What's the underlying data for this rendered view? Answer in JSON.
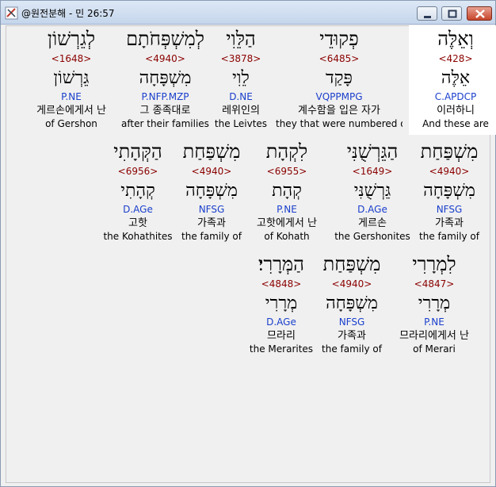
{
  "window": {
    "title": "@원전분해 - 민 26:57"
  },
  "words": [
    {
      "hebrew": "וְאֵלֶּה",
      "number": "<428>",
      "lemma": "אֵלֶּה",
      "morph": "C.APDCP",
      "korean": "이러하니",
      "english": "And these are",
      "highlighted": true
    },
    {
      "hebrew": "פְקוּדֵי",
      "number": "<6485>",
      "lemma": "פָּקַד",
      "morph": "VQPPMPG",
      "korean": "계수함을 입은 자가",
      "english": "they that were numbered of"
    },
    {
      "hebrew": "הַלֵּוִי",
      "number": "<3878>",
      "lemma": "לֵוִי",
      "morph": "D.NE",
      "korean": "레위인의",
      "english": "the Leivtes"
    },
    {
      "hebrew": "לְמִשְׁפְּחֹתָם",
      "number": "<4940>",
      "lemma": "מִשְׁפָּחָה",
      "morph": "P.NFP.MZP",
      "korean": "그 종족대로",
      "english": "after their families"
    },
    {
      "hebrew": "לְגֵרְשׁוֹן",
      "number": "<1648>",
      "lemma": "גֵּרְשׁוֹן",
      "morph": "P.NE",
      "korean": "게르손에게서 난",
      "english": "of Gershon"
    },
    {
      "hebrew": "מִשְׁפַּחַת",
      "number": "<4940>",
      "lemma": "מִשְׁפָּחָה",
      "morph": "NFSG",
      "korean": "가족과",
      "english": "the family of"
    },
    {
      "hebrew": "הַגֵּרְשֻׁנִּי",
      "number": "<1649>",
      "lemma": "גֵּרְשֻׁנִּי",
      "morph": "D.AGe",
      "korean": "게르손",
      "english": "the Gershonites"
    },
    {
      "hebrew": "לִקְהָת",
      "number": "<6955>",
      "lemma": "קְהָת",
      "morph": "P.NE",
      "korean": "고핫에게서 난",
      "english": "of Kohath"
    },
    {
      "hebrew": "מִשְׁפַּחַת",
      "number": "<4940>",
      "lemma": "מִשְׁפָּחָה",
      "morph": "NFSG",
      "korean": "가족과",
      "english": "the family of"
    },
    {
      "hebrew": "הַקְּהָתִי",
      "number": "<6956>",
      "lemma": "קְהָתִי",
      "morph": "D.AGe",
      "korean": "고핫",
      "english": "the Kohathites"
    },
    {
      "hebrew": "לִמְרָרִי",
      "number": "<4847>",
      "lemma": "מְרָרִי",
      "morph": "P.NE",
      "korean": "므라리에게서 난",
      "english": "of Merari"
    },
    {
      "hebrew": "מִשְׁפַּחַת",
      "number": "<4940>",
      "lemma": "מִשְׁפָּחָה",
      "morph": "NFSG",
      "korean": "가족과",
      "english": "the family of"
    },
    {
      "hebrew": "הַמְּרָרִי׃",
      "number": "<4848>",
      "lemma": "מְרָרִי",
      "morph": "D.AGe",
      "korean": "므라리",
      "english": "the Merarites"
    }
  ]
}
